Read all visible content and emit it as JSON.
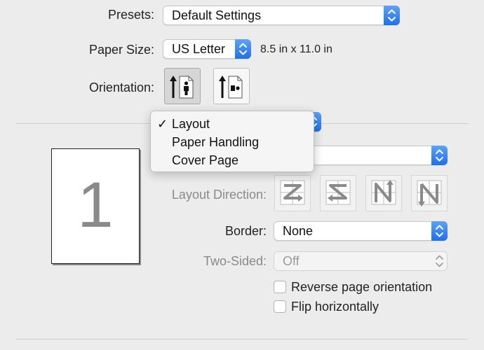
{
  "presets": {
    "label": "Presets:",
    "value": "Default Settings"
  },
  "paper_size": {
    "label": "Paper Size:",
    "value": "US Letter",
    "dimensions": "8.5 in x 11.0 in"
  },
  "orientation": {
    "label": "Orientation:",
    "options": [
      "portrait",
      "landscape"
    ],
    "selected": "portrait"
  },
  "section_menu": {
    "items": [
      "Layout",
      "Paper Handling",
      "Cover Page"
    ],
    "selected": "Layout",
    "check_glyph": "✓"
  },
  "preview": {
    "page_number": "1"
  },
  "layout_direction": {
    "label": "Layout Direction:"
  },
  "border": {
    "label": "Border:",
    "value": "None"
  },
  "two_sided": {
    "label": "Two-Sided:",
    "value": "Off"
  },
  "reverse_orientation": {
    "label": "Reverse page orientation",
    "checked": false
  },
  "flip_horizontally": {
    "label": "Flip horizontally",
    "checked": false
  },
  "colors": {
    "accent": "#2f7cf6",
    "background": "#ececec"
  }
}
